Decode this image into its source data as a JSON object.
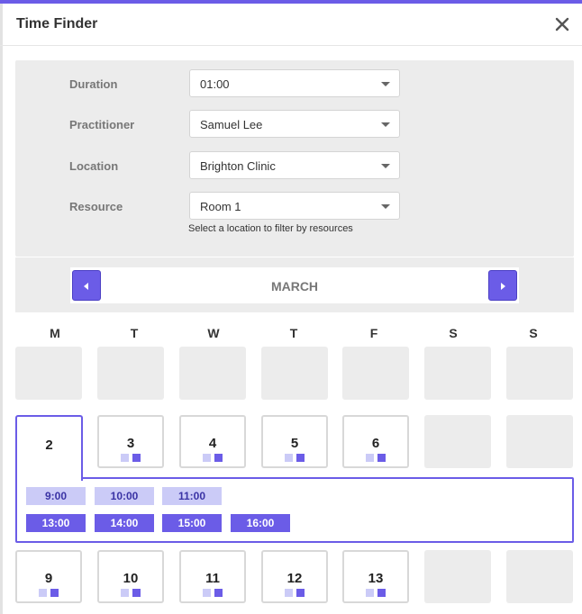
{
  "dialog": {
    "title": "Time Finder"
  },
  "filters": {
    "duration": {
      "label": "Duration",
      "value": "01:00"
    },
    "practitioner": {
      "label": "Practitioner",
      "value": "Samuel Lee"
    },
    "location": {
      "label": "Location",
      "value": "Brighton Clinic"
    },
    "resource": {
      "label": "Resource",
      "value": "Room 1",
      "hint": "Select a location to filter by resources"
    }
  },
  "calendar": {
    "month": "MARCH",
    "weekdays": [
      "M",
      "T",
      "W",
      "T",
      "F",
      "S",
      "S"
    ],
    "week2": [
      "2",
      "3",
      "4",
      "5",
      "6"
    ],
    "week3": [
      "9",
      "10",
      "11",
      "12",
      "13"
    ],
    "selected_day": "2"
  },
  "slots": {
    "morning": [
      "9:00",
      "10:00",
      "11:00"
    ],
    "afternoon": [
      "13:00",
      "14:00",
      "15:00",
      "16:00"
    ]
  },
  "colors": {
    "accent": "#6b5ce7",
    "slot_light": "#cbcbf7",
    "empty_cell": "#ececec"
  }
}
